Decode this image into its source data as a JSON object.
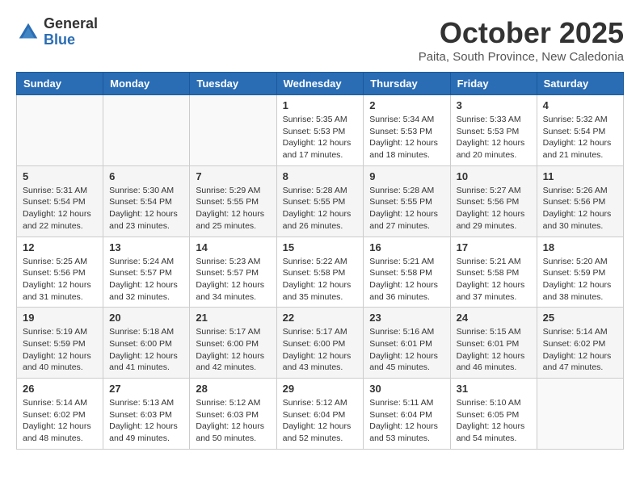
{
  "logo": {
    "general": "General",
    "blue": "Blue"
  },
  "header": {
    "month": "October 2025",
    "location": "Paita, South Province, New Caledonia"
  },
  "weekdays": [
    "Sunday",
    "Monday",
    "Tuesday",
    "Wednesday",
    "Thursday",
    "Friday",
    "Saturday"
  ],
  "weeks": [
    [
      {
        "day": "",
        "info": ""
      },
      {
        "day": "",
        "info": ""
      },
      {
        "day": "",
        "info": ""
      },
      {
        "day": "1",
        "info": "Sunrise: 5:35 AM\nSunset: 5:53 PM\nDaylight: 12 hours\nand 17 minutes."
      },
      {
        "day": "2",
        "info": "Sunrise: 5:34 AM\nSunset: 5:53 PM\nDaylight: 12 hours\nand 18 minutes."
      },
      {
        "day": "3",
        "info": "Sunrise: 5:33 AM\nSunset: 5:53 PM\nDaylight: 12 hours\nand 20 minutes."
      },
      {
        "day": "4",
        "info": "Sunrise: 5:32 AM\nSunset: 5:54 PM\nDaylight: 12 hours\nand 21 minutes."
      }
    ],
    [
      {
        "day": "5",
        "info": "Sunrise: 5:31 AM\nSunset: 5:54 PM\nDaylight: 12 hours\nand 22 minutes."
      },
      {
        "day": "6",
        "info": "Sunrise: 5:30 AM\nSunset: 5:54 PM\nDaylight: 12 hours\nand 23 minutes."
      },
      {
        "day": "7",
        "info": "Sunrise: 5:29 AM\nSunset: 5:55 PM\nDaylight: 12 hours\nand 25 minutes."
      },
      {
        "day": "8",
        "info": "Sunrise: 5:28 AM\nSunset: 5:55 PM\nDaylight: 12 hours\nand 26 minutes."
      },
      {
        "day": "9",
        "info": "Sunrise: 5:28 AM\nSunset: 5:55 PM\nDaylight: 12 hours\nand 27 minutes."
      },
      {
        "day": "10",
        "info": "Sunrise: 5:27 AM\nSunset: 5:56 PM\nDaylight: 12 hours\nand 29 minutes."
      },
      {
        "day": "11",
        "info": "Sunrise: 5:26 AM\nSunset: 5:56 PM\nDaylight: 12 hours\nand 30 minutes."
      }
    ],
    [
      {
        "day": "12",
        "info": "Sunrise: 5:25 AM\nSunset: 5:56 PM\nDaylight: 12 hours\nand 31 minutes."
      },
      {
        "day": "13",
        "info": "Sunrise: 5:24 AM\nSunset: 5:57 PM\nDaylight: 12 hours\nand 32 minutes."
      },
      {
        "day": "14",
        "info": "Sunrise: 5:23 AM\nSunset: 5:57 PM\nDaylight: 12 hours\nand 34 minutes."
      },
      {
        "day": "15",
        "info": "Sunrise: 5:22 AM\nSunset: 5:58 PM\nDaylight: 12 hours\nand 35 minutes."
      },
      {
        "day": "16",
        "info": "Sunrise: 5:21 AM\nSunset: 5:58 PM\nDaylight: 12 hours\nand 36 minutes."
      },
      {
        "day": "17",
        "info": "Sunrise: 5:21 AM\nSunset: 5:58 PM\nDaylight: 12 hours\nand 37 minutes."
      },
      {
        "day": "18",
        "info": "Sunrise: 5:20 AM\nSunset: 5:59 PM\nDaylight: 12 hours\nand 38 minutes."
      }
    ],
    [
      {
        "day": "19",
        "info": "Sunrise: 5:19 AM\nSunset: 5:59 PM\nDaylight: 12 hours\nand 40 minutes."
      },
      {
        "day": "20",
        "info": "Sunrise: 5:18 AM\nSunset: 6:00 PM\nDaylight: 12 hours\nand 41 minutes."
      },
      {
        "day": "21",
        "info": "Sunrise: 5:17 AM\nSunset: 6:00 PM\nDaylight: 12 hours\nand 42 minutes."
      },
      {
        "day": "22",
        "info": "Sunrise: 5:17 AM\nSunset: 6:00 PM\nDaylight: 12 hours\nand 43 minutes."
      },
      {
        "day": "23",
        "info": "Sunrise: 5:16 AM\nSunset: 6:01 PM\nDaylight: 12 hours\nand 45 minutes."
      },
      {
        "day": "24",
        "info": "Sunrise: 5:15 AM\nSunset: 6:01 PM\nDaylight: 12 hours\nand 46 minutes."
      },
      {
        "day": "25",
        "info": "Sunrise: 5:14 AM\nSunset: 6:02 PM\nDaylight: 12 hours\nand 47 minutes."
      }
    ],
    [
      {
        "day": "26",
        "info": "Sunrise: 5:14 AM\nSunset: 6:02 PM\nDaylight: 12 hours\nand 48 minutes."
      },
      {
        "day": "27",
        "info": "Sunrise: 5:13 AM\nSunset: 6:03 PM\nDaylight: 12 hours\nand 49 minutes."
      },
      {
        "day": "28",
        "info": "Sunrise: 5:12 AM\nSunset: 6:03 PM\nDaylight: 12 hours\nand 50 minutes."
      },
      {
        "day": "29",
        "info": "Sunrise: 5:12 AM\nSunset: 6:04 PM\nDaylight: 12 hours\nand 52 minutes."
      },
      {
        "day": "30",
        "info": "Sunrise: 5:11 AM\nSunset: 6:04 PM\nDaylight: 12 hours\nand 53 minutes."
      },
      {
        "day": "31",
        "info": "Sunrise: 5:10 AM\nSunset: 6:05 PM\nDaylight: 12 hours\nand 54 minutes."
      },
      {
        "day": "",
        "info": ""
      }
    ]
  ]
}
